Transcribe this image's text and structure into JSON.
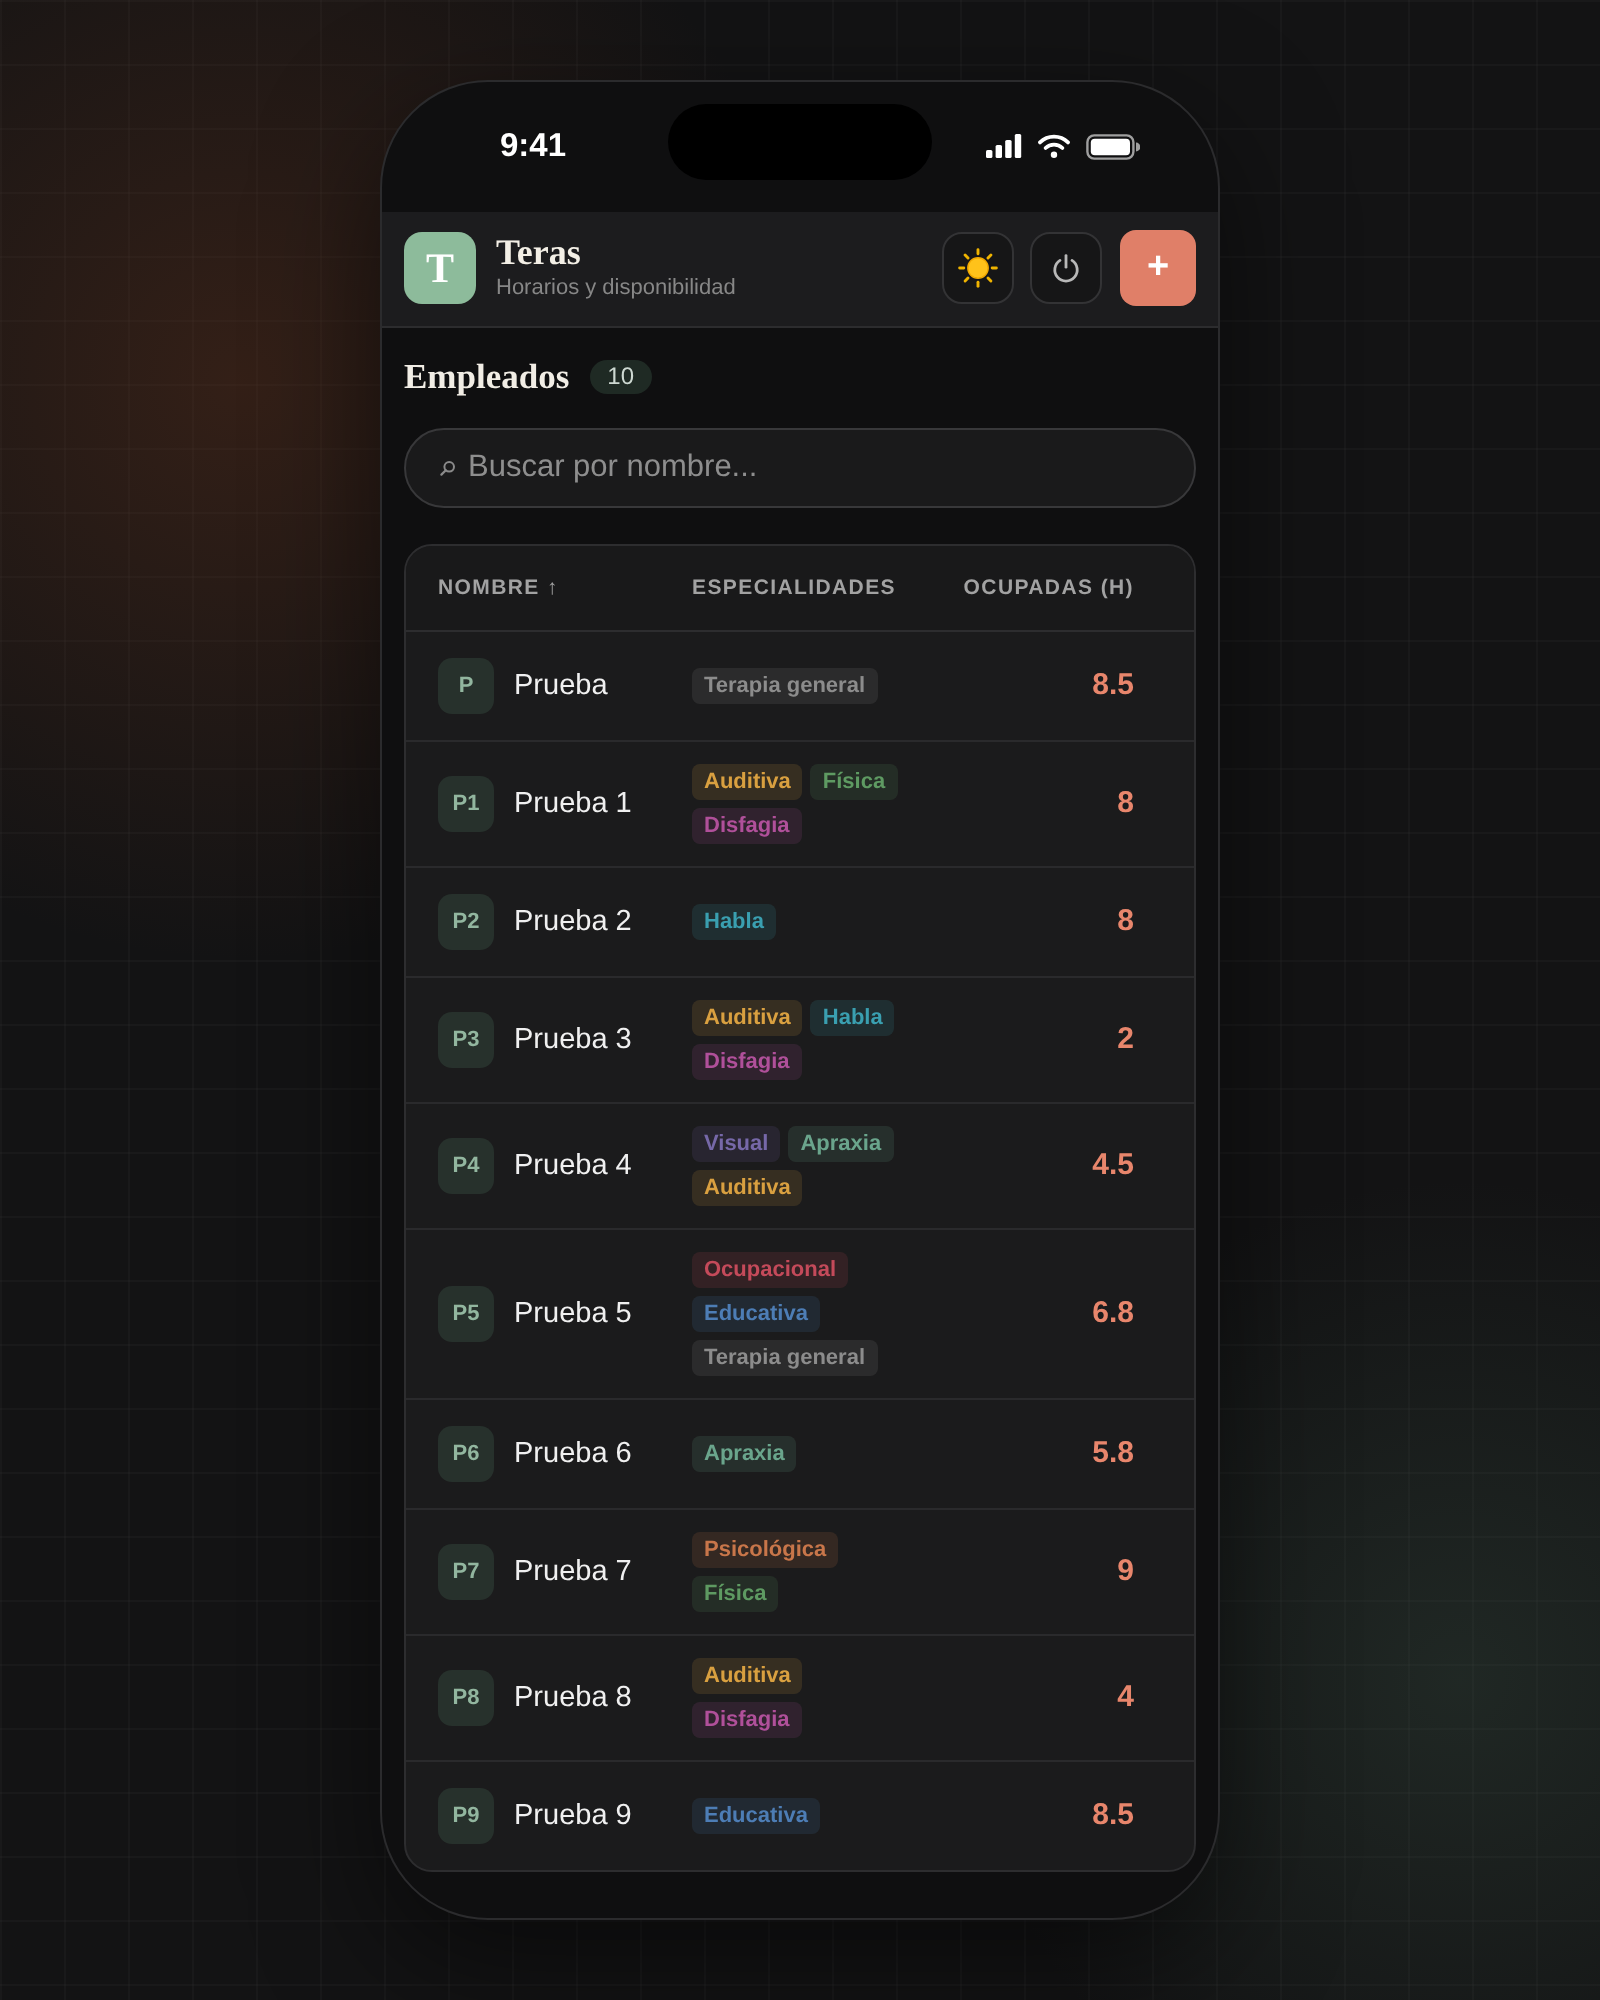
{
  "status_bar": {
    "time": "9:41"
  },
  "header": {
    "logo_letter": "T",
    "title": "Teras",
    "subtitle": "Horarios y disponibilidad",
    "actions": [
      {
        "kind": "theme"
      },
      {
        "kind": "power"
      },
      {
        "kind": "add",
        "label": "+"
      }
    ]
  },
  "section": {
    "title": "Empleados",
    "count": "10"
  },
  "search": {
    "placeholder": "Buscar por nombre..."
  },
  "table": {
    "columns": [
      {
        "label": "NOMBRE ↑"
      },
      {
        "label": "ESPECIALIDADES"
      },
      {
        "label": "OCUPADAS (H)"
      }
    ],
    "rows": [
      {
        "initials": "P",
        "name": "Prueba",
        "tags": [
          {
            "label": "Terapia general",
            "color": "#8c8c8c"
          }
        ],
        "hours": "8.5"
      },
      {
        "initials": "P1",
        "name": "Prueba 1",
        "tags": [
          {
            "label": "Auditiva",
            "color": "#d9a040"
          },
          {
            "label": "Física",
            "color": "#5e9a62"
          },
          {
            "label": "Disfagia",
            "color": "#b0509a"
          }
        ],
        "hours": "8"
      },
      {
        "initials": "P2",
        "name": "Prueba 2",
        "tags": [
          {
            "label": "Habla",
            "color": "#3a9fb0"
          }
        ],
        "hours": "8"
      },
      {
        "initials": "P3",
        "name": "Prueba 3",
        "tags": [
          {
            "label": "Auditiva",
            "color": "#d9a040"
          },
          {
            "label": "Habla",
            "color": "#3a9fb0"
          },
          {
            "label": "Disfagia",
            "color": "#b0509a"
          }
        ],
        "hours": "2"
      },
      {
        "initials": "P4",
        "name": "Prueba 4",
        "tags": [
          {
            "label": "Visual",
            "color": "#7668a8"
          },
          {
            "label": "Apraxia",
            "color": "#6aa58c"
          },
          {
            "label": "Auditiva",
            "color": "#d9a040"
          }
        ],
        "hours": "4.5"
      },
      {
        "initials": "P5",
        "name": "Prueba 5",
        "tags": [
          {
            "label": "Ocupacional",
            "color": "#c44a5a"
          },
          {
            "label": "Educativa",
            "color": "#4d7db5"
          },
          {
            "label": "Terapia general",
            "color": "#8c8c8c"
          }
        ],
        "hours": "6.8"
      },
      {
        "initials": "P6",
        "name": "Prueba 6",
        "tags": [
          {
            "label": "Apraxia",
            "color": "#6aa58c"
          }
        ],
        "hours": "5.8"
      },
      {
        "initials": "P7",
        "name": "Prueba 7",
        "tags": [
          {
            "label": "Psicológica",
            "color": "#c8764a"
          },
          {
            "label": "Física",
            "color": "#5e9a62"
          }
        ],
        "hours": "9"
      },
      {
        "initials": "P8",
        "name": "Prueba 8",
        "tags": [
          {
            "label": "Auditiva",
            "color": "#d9a040"
          },
          {
            "label": "Disfagia",
            "color": "#b0509a"
          }
        ],
        "hours": "4"
      },
      {
        "initials": "P9",
        "name": "Prueba 9",
        "tags": [
          {
            "label": "Educativa",
            "color": "#4d7db5"
          }
        ],
        "hours": "8.5"
      }
    ]
  }
}
